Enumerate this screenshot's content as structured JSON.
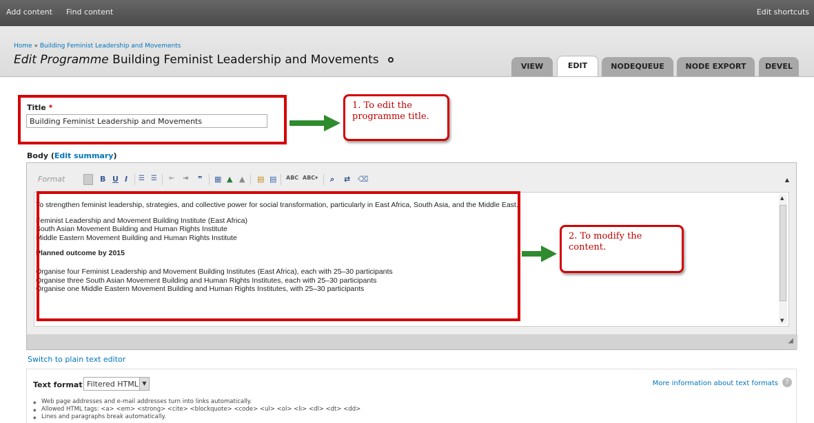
{
  "toolbar": {
    "add_content": "Add content",
    "find_content": "Find content",
    "edit_shortcuts": "Edit shortcuts"
  },
  "breadcrumb": {
    "home": "Home",
    "separator": " » ",
    "current": "Building Feminist Leadership and Movements"
  },
  "page": {
    "title_prefix": "Edit Programme",
    "title": "Building Feminist Leadership and Movements"
  },
  "tabs": [
    {
      "label": "VIEW",
      "active": false
    },
    {
      "label": "EDIT",
      "active": true
    },
    {
      "label": "NODEQUEUE",
      "active": false
    },
    {
      "label": "NODE EXPORT",
      "active": false
    },
    {
      "label": "DEVEL",
      "active": false
    }
  ],
  "form": {
    "title_label": "Title",
    "required_mark": "*",
    "title_value": "Building Feminist Leadership and Movements",
    "body_label": "Body",
    "edit_summary": "Edit summary"
  },
  "callouts": {
    "one": "1. To edit the programme title.",
    "two": "2. To modify the content."
  },
  "editor": {
    "format_placeholder": "Format",
    "body": {
      "intro": "To strengthen feminist leadership, strategies, and collective power for social transformation, particularly in East Africa, South Asia, and the Middle East.",
      "institutes": [
        "Feminist Leadership and Movement Building Institute (East Africa)",
        "South Asian Movement Building and Human Rights Institute",
        "Middle Eastern Movement Building and Human Rights Institute"
      ],
      "outcome_heading": "Planned outcome by 2015",
      "outcomes": [
        "Organise four Feminist Leadership and Movement Building Institutes (East Africa), each with 25–30 participants",
        "Organise three South Asian Movement Building and Human Rights Institutes, each with 25–30 participants",
        "Organise one Middle Eastern Movement Building and Human Rights Institutes, with 25–30 participants"
      ]
    }
  },
  "switch_editor": "Switch to plain text editor",
  "text_format": {
    "label": "Text format",
    "selected": "Filtered HTML",
    "more_info": "More information about text formats",
    "tips": [
      "Web page addresses and e-mail addresses turn into links automatically.",
      "Allowed HTML tags: <a> <em> <strong> <cite> <blockquote> <code> <ul> <ol> <li> <dl> <dt> <dd>",
      "Lines and paragraphs break automatically."
    ]
  },
  "colors": {
    "accent_red": "#d40000",
    "link_blue": "#0074bd",
    "arrow_green": "#2e8b2e"
  }
}
